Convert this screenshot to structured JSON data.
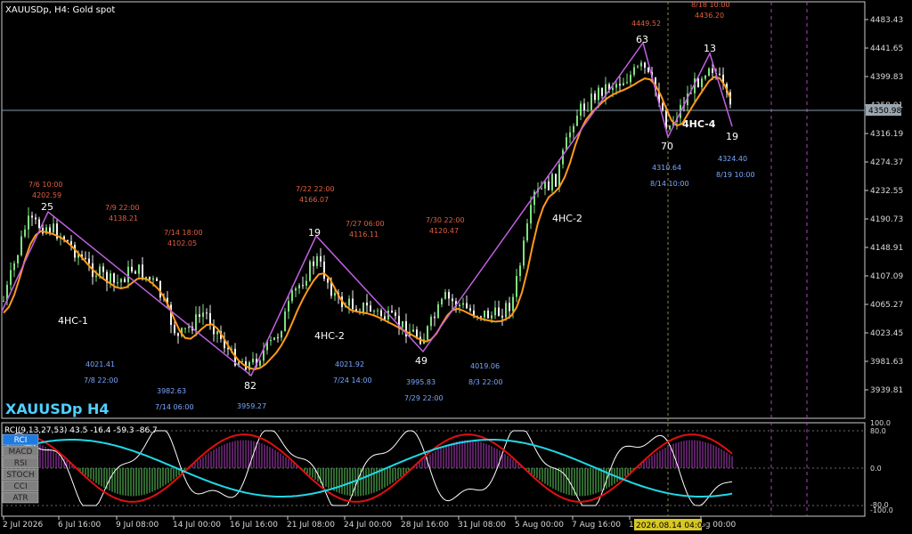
{
  "window": {
    "title": "XAUUSDp, H4:  Gold spot",
    "symbol": "XAUUSDp H4"
  },
  "colors": {
    "bg": "#000000",
    "up": "#7fe07f",
    "down": "#f2f2f2",
    "ma": "#ff9a1a",
    "zigzag": "#c060e0",
    "label_red": "#e06040",
    "label_blue": "#7aa8ff",
    "grid": "#6a6a6a",
    "price_line": "#8a9aa8",
    "price_tag_bg": "#9aa6b0",
    "rci_white": "#ffffff",
    "rci_red": "#e01010",
    "rci_cyan": "#20d8e8",
    "hist": "#b040c0",
    "hist_green": "#60d060",
    "axis_text": "#d8d8d8",
    "frame": "#cccccc"
  },
  "price_axis": [
    "4483.43",
    "4441.65",
    "4399.83",
    "4358.01",
    "4316.19",
    "4274.37",
    "4232.55",
    "4190.73",
    "4148.91",
    "4107.09",
    "4065.27",
    "4023.45",
    "3981.63",
    "3939.81"
  ],
  "current_price": "4350.98",
  "time_axis": [
    "2 Jul 2026",
    "6 Jul 16:00",
    "9 Jul 08:00",
    "14 Jul 00:00",
    "16 Jul 16:00",
    "21 Jul 08:00",
    "24 Jul 00:00",
    "28 Jul 16:00",
    "31 Jul 08:00",
    "5 Aug 00:00",
    "7 Aug 16:00",
    "1",
    "ug 00:00"
  ],
  "crosshair_time": "2026.08.14 04:00",
  "swing_counts": [
    {
      "text": "25"
    },
    {
      "text": "82"
    },
    {
      "text": "19"
    },
    {
      "text": "49"
    },
    {
      "text": "63"
    },
    {
      "text": "70"
    },
    {
      "text": "13"
    },
    {
      "text": "19"
    }
  ],
  "wave_labels": [
    {
      "text": "4HC-1"
    },
    {
      "text": "4HC-2"
    },
    {
      "text": "4HC-2"
    },
    {
      "text": "4HC-4"
    }
  ],
  "high_labels": [
    {
      "date": "7/6 10:00",
      "price": "4202.59"
    },
    {
      "date": "7/9 22:00",
      "price": "4138.21"
    },
    {
      "date": "7/14 18:00",
      "price": "4102.05"
    },
    {
      "date": "7/22 22:00",
      "price": "4166.07"
    },
    {
      "date": "7/27 06:00",
      "price": "4116.11"
    },
    {
      "date": "7/30 22:00",
      "price": "4120.47"
    },
    {
      "date": "",
      "price": "4449.52"
    },
    {
      "date": "8/18 10:00",
      "price": "4436.20"
    }
  ],
  "low_labels": [
    {
      "price": "4021.41",
      "date": "7/8 22:00"
    },
    {
      "price": "3982.63",
      "date": "7/14 06:00"
    },
    {
      "price": "3959.27",
      "date": ""
    },
    {
      "price": "4021.92",
      "date": "7/24 14:00"
    },
    {
      "price": "3995.83",
      "date": "7/29 22:00"
    },
    {
      "price": "4019.06",
      "date": "8/3 22:00"
    },
    {
      "price": "4310.64",
      "date": "8/14 10:00"
    },
    {
      "price": "4324.40",
      "date": "8/19 10:00"
    }
  ],
  "indicator": {
    "label": "RCI(9,13,27,53) 43.5 -16.4 -59.3 -86.7",
    "buttons": [
      "RCI",
      "MACD",
      "RSI",
      "STOCH",
      "CCI",
      "ATR"
    ],
    "active_button": "RCI",
    "axis": [
      "100.0",
      "80.0",
      "0.0",
      "-80.0",
      "-100.0"
    ]
  }
}
